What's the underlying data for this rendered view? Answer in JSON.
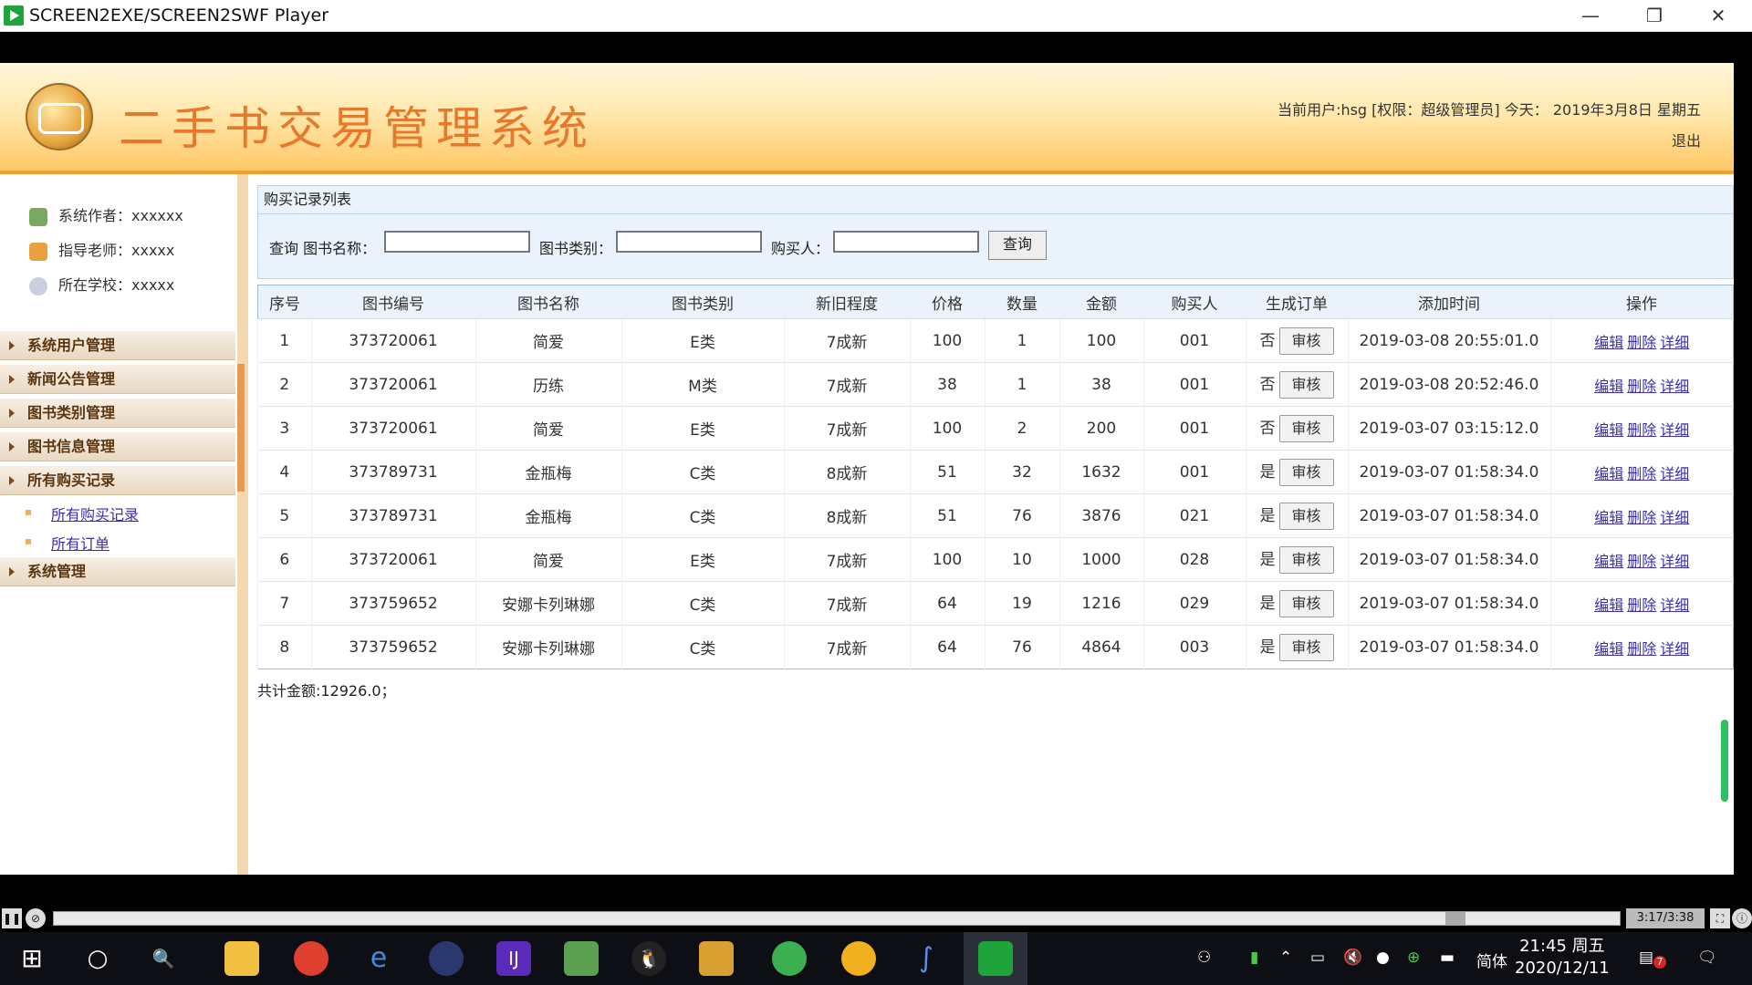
{
  "window": {
    "title": "SCREEN2EXE/SCREEN2SWF Player",
    "minimize": "—",
    "restore": "❐",
    "close": "✕"
  },
  "header": {
    "system_title": "二手书交易管理系统",
    "user_info": "当前用户:hsg [权限：超级管理员] 今天： 2019年3月8日 星期五",
    "logout": "退出"
  },
  "sidebar": {
    "info": [
      "系统作者：xxxxxx",
      "指导老师：xxxxx",
      "所在学校：xxxxx"
    ],
    "menus": {
      "m1": "系统用户管理",
      "m2": "新闻公告管理",
      "m3": "图书类别管理",
      "m4": "图书信息管理",
      "m5": "所有购买记录",
      "m6": "系统管理"
    },
    "submenus": [
      "所有购买记录",
      "所有订单"
    ]
  },
  "main": {
    "panel_title": "购买记录列表",
    "search": {
      "query_label": "查询 图书名称：",
      "category_label": "图书类别：",
      "buyer_label": "购买人：",
      "book_name_value": "",
      "category_value": "",
      "buyer_value": "",
      "button": "查询"
    },
    "columns": [
      "序号",
      "图书编号",
      "图书名称",
      "图书类别",
      "新旧程度",
      "价格",
      "数量",
      "金额",
      "购买人",
      "生成订单",
      "添加时间",
      "操作"
    ],
    "audit_label": "审核",
    "ops": [
      "编辑",
      "删除",
      "详细"
    ],
    "rows": [
      {
        "no": "1",
        "code": "373720061",
        "name": "简爱",
        "cat": "E类",
        "cond": "7成新",
        "price": "100",
        "qty": "1",
        "amount": "100",
        "buyer": "001",
        "order": "否",
        "time": "2019-03-08 20:55:01.0"
      },
      {
        "no": "2",
        "code": "373720061",
        "name": "历练",
        "cat": "M类",
        "cond": "7成新",
        "price": "38",
        "qty": "1",
        "amount": "38",
        "buyer": "001",
        "order": "否",
        "time": "2019-03-08 20:52:46.0"
      },
      {
        "no": "3",
        "code": "373720061",
        "name": "简爱",
        "cat": "E类",
        "cond": "7成新",
        "price": "100",
        "qty": "2",
        "amount": "200",
        "buyer": "001",
        "order": "否",
        "time": "2019-03-07 03:15:12.0"
      },
      {
        "no": "4",
        "code": "373789731",
        "name": "金瓶梅",
        "cat": "C类",
        "cond": "8成新",
        "price": "51",
        "qty": "32",
        "amount": "1632",
        "buyer": "001",
        "order": "是",
        "time": "2019-03-07 01:58:34.0"
      },
      {
        "no": "5",
        "code": "373789731",
        "name": "金瓶梅",
        "cat": "C类",
        "cond": "8成新",
        "price": "51",
        "qty": "76",
        "amount": "3876",
        "buyer": "021",
        "order": "是",
        "time": "2019-03-07 01:58:34.0"
      },
      {
        "no": "6",
        "code": "373720061",
        "name": "简爱",
        "cat": "E类",
        "cond": "7成新",
        "price": "100",
        "qty": "10",
        "amount": "1000",
        "buyer": "028",
        "order": "是",
        "time": "2019-03-07 01:58:34.0"
      },
      {
        "no": "7",
        "code": "373759652",
        "name": "安娜卡列琳娜",
        "cat": "C类",
        "cond": "7成新",
        "price": "64",
        "qty": "19",
        "amount": "1216",
        "buyer": "029",
        "order": "是",
        "time": "2019-03-07 01:58:34.0"
      },
      {
        "no": "8",
        "code": "373759652",
        "name": "安娜卡列琳娜",
        "cat": "C类",
        "cond": "7成新",
        "price": "64",
        "qty": "76",
        "amount": "4864",
        "buyer": "003",
        "order": "是",
        "time": "2019-03-07 01:58:34.0"
      }
    ],
    "total": "共计金额:12926.0；"
  },
  "player": {
    "time": "3:17/3:38",
    "progress": 0.9
  },
  "taskbar": {
    "ime": "简体",
    "time": "21:45 周五",
    "date": "2020/12/11",
    "notification_count": "7"
  }
}
